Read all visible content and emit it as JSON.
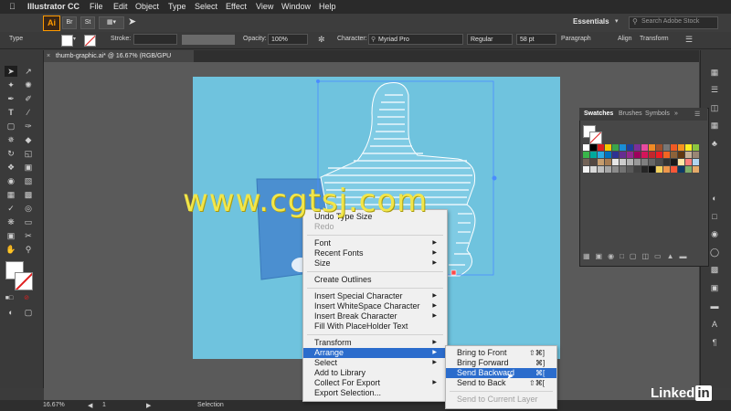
{
  "menubar": {
    "apple": "",
    "app": "Illustrator CC",
    "items": [
      "File",
      "Edit",
      "Object",
      "Type",
      "Select",
      "Effect",
      "View",
      "Window",
      "Help"
    ]
  },
  "appbar": {
    "logo": "Ai",
    "btn_br": "Br",
    "btn_st": "St",
    "workspace": "Essentials",
    "search_placeholder": "Search Adobe Stock"
  },
  "control": {
    "type_label": "Type",
    "stroke_label": "Stroke:",
    "opacity_label": "Opacity:",
    "opacity_value": "100%",
    "character_label": "Character:",
    "font_family": "Myriad Pro",
    "font_style": "Regular",
    "font_size": "58 pt",
    "paragraph_label": "Paragraph",
    "align_label": "Align",
    "transform_label": "Transform"
  },
  "document": {
    "tab_title": "thumb-graphic.ai* @ 16.67% (RGB/GPU Preview)"
  },
  "swatches": {
    "tabs": [
      "Swatches",
      "Brushes",
      "Symbols"
    ],
    "colors": [
      "#ffffff",
      "#000000",
      "#e02020",
      "#f5c800",
      "#3ba54a",
      "#1a8ed6",
      "#1d3f9b",
      "#7a2f9a",
      "#e84aa0",
      "#f08a24",
      "#a0522d",
      "#777777",
      "#f15a24",
      "#f7931e",
      "#fcee21",
      "#8cc63f",
      "#39b54a",
      "#00a99d",
      "#29abe2",
      "#0071bc",
      "#2e3192",
      "#662d91",
      "#93278f",
      "#9e005d",
      "#d4145a",
      "#c1272d",
      "#ed1c24",
      "#f26522",
      "#8c6239",
      "#603813",
      "#c7b299",
      "#998675",
      "#736357",
      "#534741",
      "#c69c6d",
      "#a67c52",
      "#e6e6e6",
      "#cccccc",
      "#b3b3b3",
      "#999999",
      "#808080",
      "#666666",
      "#4d4d4d",
      "#333333",
      "#1a1a1a",
      "#ffe7a6",
      "#ff7e79",
      "#b0d5f0"
    ]
  },
  "context_menu": {
    "items": [
      {
        "label": "Undo Type Size",
        "disabled": false,
        "submenu": false
      },
      {
        "label": "Redo",
        "disabled": true,
        "submenu": false
      },
      {
        "label": "Font",
        "disabled": false,
        "submenu": true
      },
      {
        "label": "Recent Fonts",
        "disabled": false,
        "submenu": true
      },
      {
        "label": "Size",
        "disabled": false,
        "submenu": true
      },
      {
        "label": "Create Outlines",
        "disabled": false,
        "submenu": false
      },
      {
        "label": "Insert Special Character",
        "disabled": false,
        "submenu": true
      },
      {
        "label": "Insert WhiteSpace Character",
        "disabled": false,
        "submenu": true
      },
      {
        "label": "Insert Break Character",
        "disabled": false,
        "submenu": true
      },
      {
        "label": "Fill With PlaceHolder Text",
        "disabled": false,
        "submenu": false
      },
      {
        "label": "Transform",
        "disabled": false,
        "submenu": true
      },
      {
        "label": "Arrange",
        "disabled": false,
        "submenu": true,
        "highlighted": true
      },
      {
        "label": "Select",
        "disabled": false,
        "submenu": true
      },
      {
        "label": "Add to Library",
        "disabled": false,
        "submenu": false
      },
      {
        "label": "Collect For Export",
        "disabled": false,
        "submenu": true
      },
      {
        "label": "Export Selection...",
        "disabled": false,
        "submenu": false
      }
    ]
  },
  "arrange_submenu": {
    "items": [
      {
        "label": "Bring to Front",
        "shortcut": "⇧⌘]",
        "disabled": false
      },
      {
        "label": "Bring Forward",
        "shortcut": "⌘]",
        "disabled": false
      },
      {
        "label": "Send Backward",
        "shortcut": "⌘[",
        "disabled": false,
        "highlighted": true
      },
      {
        "label": "Send to Back",
        "shortcut": "⇧⌘[",
        "disabled": false
      },
      {
        "label": "Send to Current Layer",
        "shortcut": "",
        "disabled": true
      }
    ]
  },
  "status": {
    "zoom": "16.67%",
    "artboard": "1",
    "tool": "Selection"
  },
  "watermark": "www.cgtsj.com",
  "brand": "Linked in",
  "colors": {
    "artboard": "#6fc3de",
    "highlight": "#2b6ccc",
    "watermark": "#f2e64a"
  }
}
